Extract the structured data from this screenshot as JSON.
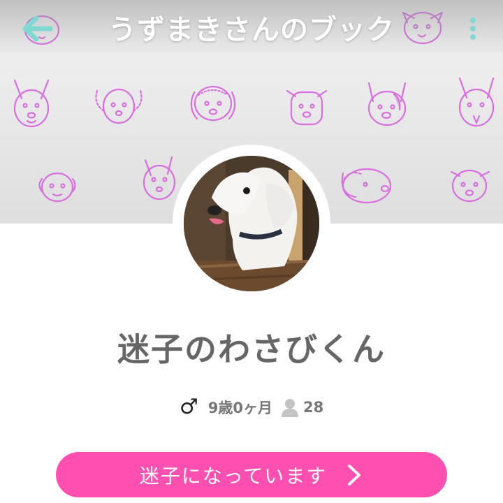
{
  "header": {
    "title": "うずまきさんのブック",
    "back_icon": "arrow-left-icon",
    "menu_icon": "more-vertical-icon",
    "accent_color": "#7fd9d2"
  },
  "cover": {
    "pattern": "dog-doodle-pattern",
    "pattern_color": "#d86ee0"
  },
  "profile": {
    "name": "迷子のわさびくん",
    "gender_symbol": "♂",
    "age": "9歳0ヶ月",
    "followers": "28",
    "follower_icon": "person-icon"
  },
  "action": {
    "label": "迷子になっています",
    "icon": "chevron-right-icon",
    "color": "#ff4fb0"
  }
}
